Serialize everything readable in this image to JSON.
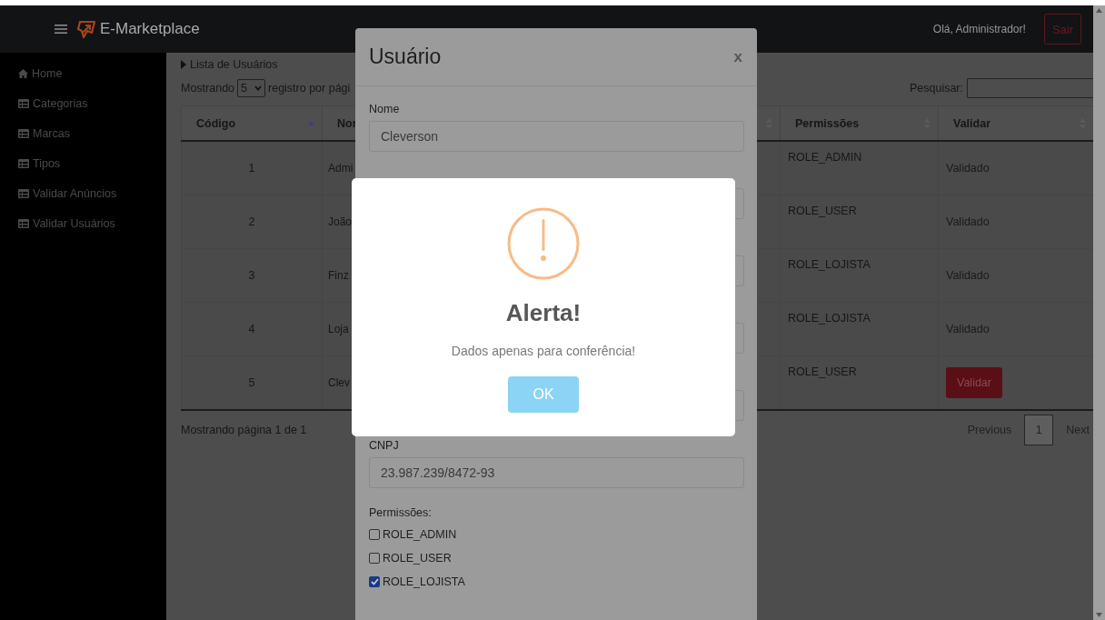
{
  "navbar": {
    "brand": "E-Marketplace",
    "greeting": "Olá, Administrador!",
    "logout": "Sair"
  },
  "sidebar": {
    "items": [
      {
        "label": "Home",
        "kind": "home"
      },
      {
        "label": "Categorias",
        "kind": "table"
      },
      {
        "label": "Marcas",
        "kind": "table"
      },
      {
        "label": "Tipos",
        "kind": "table"
      },
      {
        "label": "Validar Anúncios",
        "kind": "table"
      },
      {
        "label": "Validar Usuários",
        "kind": "table"
      }
    ]
  },
  "content": {
    "breadcrumb": "Lista de Usuários",
    "length_prefix": "Mostrando",
    "length_value": "5",
    "length_suffix": "registro por pági",
    "search_label": "Pesquisar:"
  },
  "table": {
    "columns": [
      {
        "label": "Código",
        "sorted": true
      },
      {
        "label": "Nor"
      },
      {
        "sorted": false
      },
      {
        "label": "Permissões",
        "sorted": false
      },
      {
        "label": "Validar",
        "sorted": false
      }
    ],
    "rows": [
      {
        "code": "1",
        "name": "Admi",
        "permission": "ROLE_ADMIN",
        "validated": true,
        "status": "Validado"
      },
      {
        "code": "2",
        "name": "João",
        "permission": "ROLE_USER",
        "validated": true,
        "status": "Validado"
      },
      {
        "code": "3",
        "name": "Finz",
        "permission": "ROLE_LOJISTA",
        "validated": true,
        "status": "Validado"
      },
      {
        "code": "4",
        "name": "Loja",
        "permission": "ROLE_LOJISTA",
        "validated": true,
        "status": "Validado"
      },
      {
        "code": "5",
        "name": "Clev",
        "permission": "ROLE_USER",
        "validated": false,
        "status": "Validar"
      }
    ]
  },
  "pagination": {
    "info": "Mostrando página 1 de 1",
    "previous": "Previous",
    "pages": [
      {
        "label": "1",
        "selected": true
      }
    ],
    "next": "Next"
  },
  "modal": {
    "title": "Usuário",
    "close": "x",
    "fields": [
      {
        "kind": "field",
        "label": "Nome",
        "value": "Cleverson"
      },
      {
        "kind": "covered"
      },
      {
        "kind": "covered"
      },
      {
        "kind": "covered"
      },
      {
        "kind": "covered"
      },
      {
        "kind": "field",
        "label": "CNPJ",
        "value": "23.987.239/8472-93"
      }
    ],
    "permissions_label": "Permissões:",
    "permissions": [
      {
        "label": "ROLE_ADMIN",
        "checked": false
      },
      {
        "label": "ROLE_USER",
        "checked": false
      },
      {
        "label": "ROLE_LOJISTA",
        "checked": true
      }
    ]
  },
  "alert": {
    "title": "Alerta!",
    "text": "Dados apenas para conferência!",
    "button": "OK"
  }
}
